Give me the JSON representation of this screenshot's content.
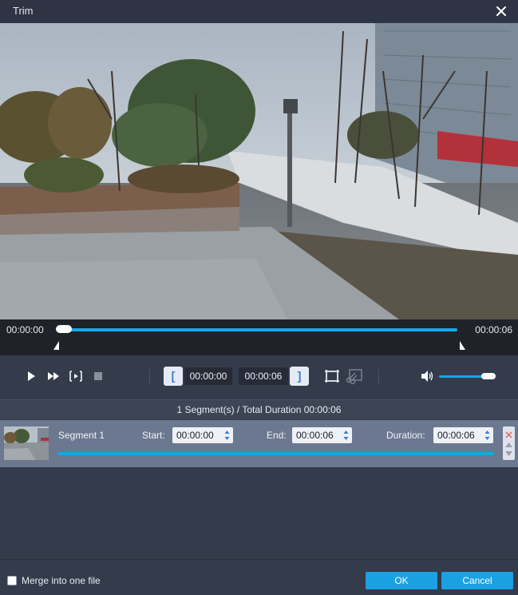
{
  "window": {
    "title": "Trim"
  },
  "timeline": {
    "start_time": "00:00:00",
    "end_time": "00:00:06",
    "playhead_progress": 0.0
  },
  "toolbar": {
    "start_value": "00:00:00",
    "end_value": "00:00:06",
    "set_start_glyph": "[",
    "set_end_glyph": "]",
    "volume_level": 0.85
  },
  "segments": {
    "summary": "1 Segment(s) / Total Duration 00:00:06",
    "items": [
      {
        "name": "Segment 1",
        "start_label": "Start:",
        "start": "00:00:00",
        "end_label": "End:",
        "end": "00:00:06",
        "duration_label": "Duration:",
        "duration": "00:00:06"
      }
    ]
  },
  "footer": {
    "merge_label": "Merge into one file",
    "merge_checked": false,
    "ok_label": "OK",
    "cancel_label": "Cancel"
  },
  "colors": {
    "accent": "#1aa1e2",
    "background": "#343b4b",
    "timeline_bg": "#1f2229",
    "segment_row": "#6b7890"
  },
  "icons": [
    "close-icon",
    "play-icon",
    "fast-forward-icon",
    "play-segment-icon",
    "stop-icon",
    "set-start-icon",
    "set-end-icon",
    "crop-icon",
    "split-scissors-icon",
    "volume-icon",
    "spin-arrows-icon",
    "delete-segment-icon",
    "move-down-icon"
  ]
}
